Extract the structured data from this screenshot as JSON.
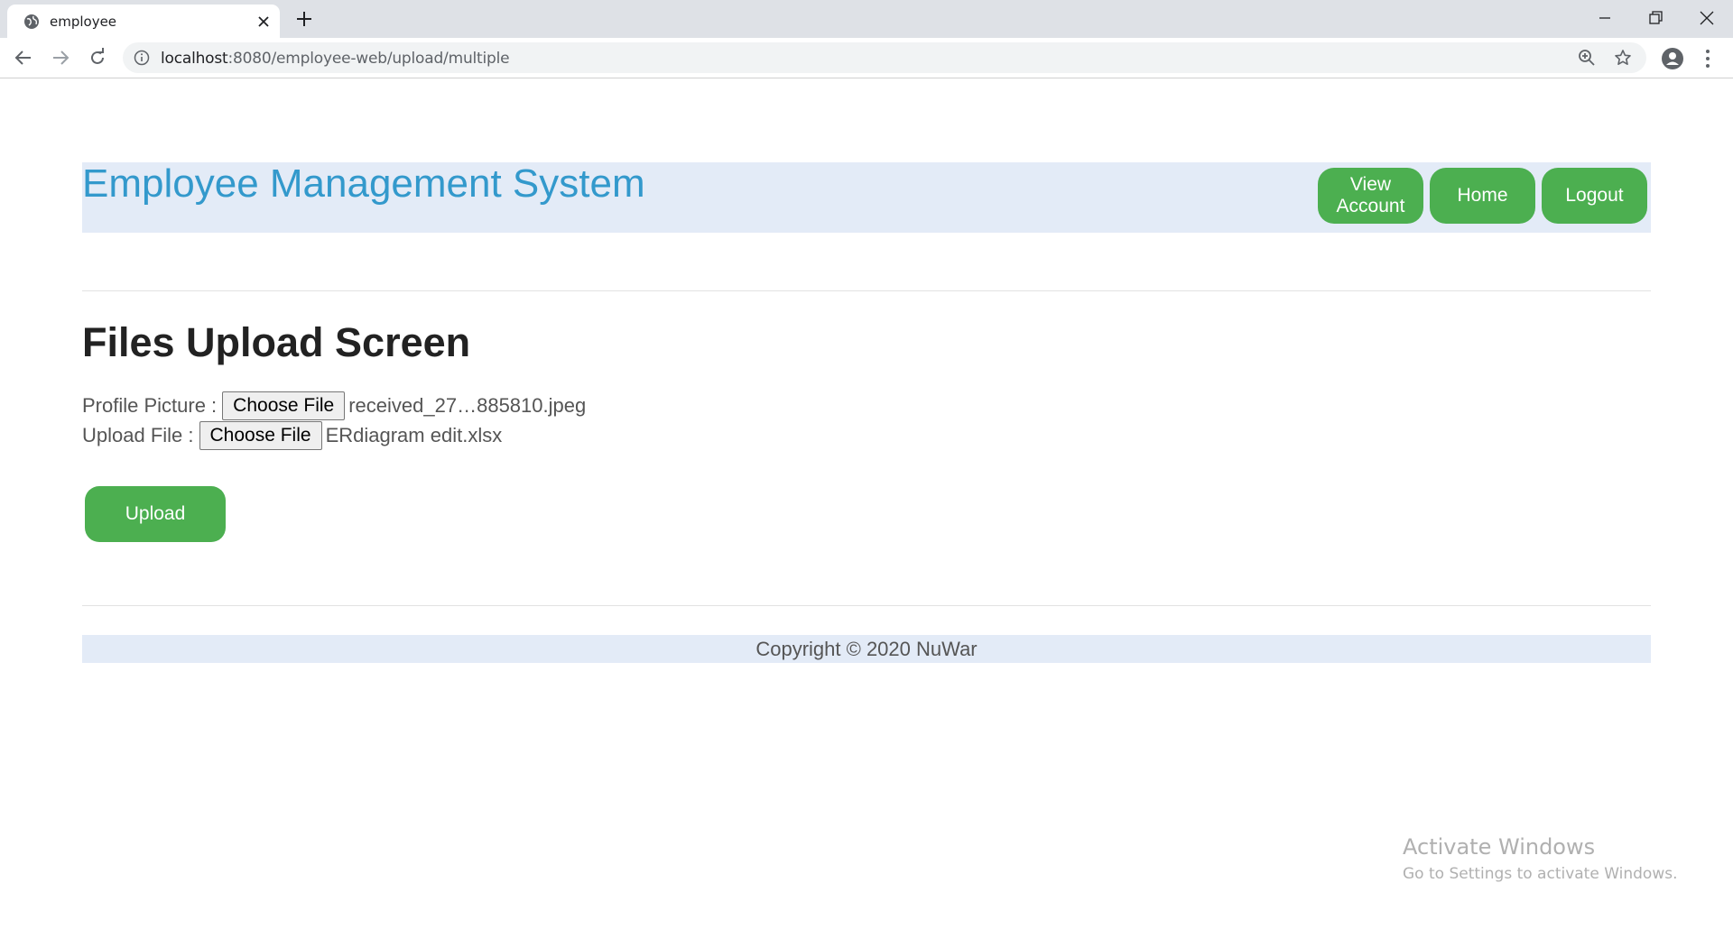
{
  "browser": {
    "tab_title": "employee",
    "url_host": "localhost",
    "url_rest": ":8080/employee-web/upload/multiple",
    "icons": [
      "globe-icon",
      "close-icon",
      "plus-icon",
      "minimize-icon",
      "restore-icon",
      "close-window-icon",
      "back-arrow-icon",
      "forward-arrow-icon",
      "reload-icon",
      "info-icon",
      "zoom-icon",
      "star-icon",
      "profile-icon",
      "kebab-menu-icon"
    ]
  },
  "header": {
    "title": "Employee Management System",
    "nav": {
      "view_account": "View Account",
      "home": "Home",
      "logout": "Logout"
    }
  },
  "main": {
    "heading": "Files Upload Screen",
    "profile_picture": {
      "label": "Profile Picture :",
      "button": "Choose File",
      "filename": "received_27…885810.jpeg"
    },
    "upload_file": {
      "label": "Upload File :",
      "button": "Choose File",
      "filename": "ERdiagram edit.xlsx"
    },
    "upload_button": "Upload"
  },
  "footer": {
    "copyright": "Copyright © 2020 NuWar"
  },
  "watermark": {
    "title": "Activate Windows",
    "subtitle": "Go to Settings to activate Windows."
  },
  "colors": {
    "accent_green": "#4caf50",
    "title_blue": "#3399cc",
    "header_bg": "#e3ebf7"
  }
}
